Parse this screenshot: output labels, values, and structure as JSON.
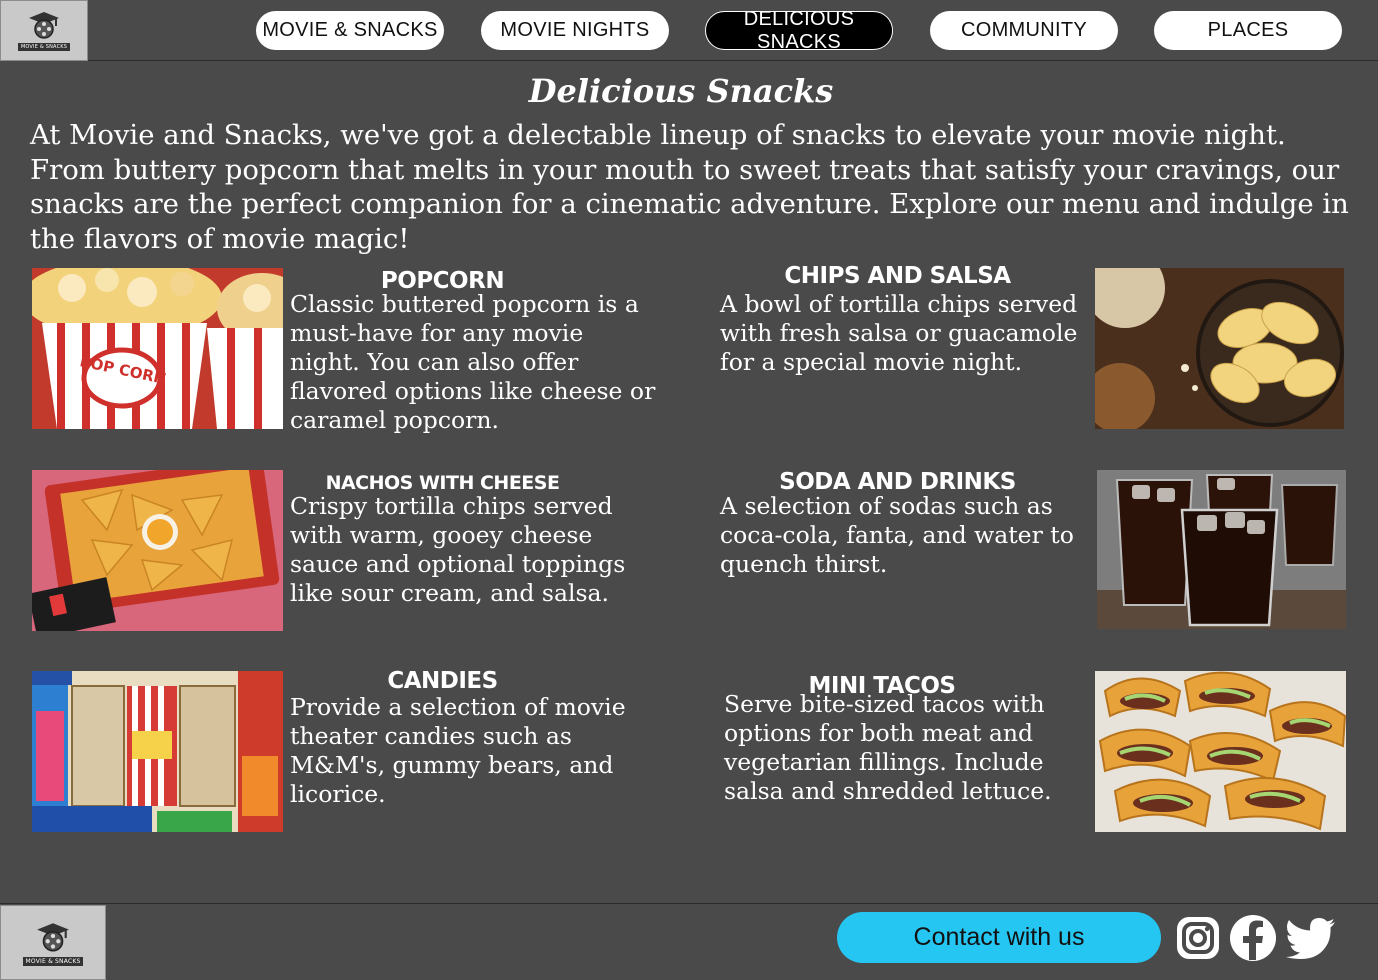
{
  "header": {
    "logo_caption": "MOVIE & SNACKS",
    "nav": [
      {
        "label": "MOVIE & SNACKS",
        "active": false
      },
      {
        "label": "MOVIE NIGHTS",
        "active": false
      },
      {
        "label": "DELICIOUS SNACKS",
        "active": true
      },
      {
        "label": "COMMUNITY",
        "active": false
      },
      {
        "label": "PLACES",
        "active": false
      }
    ]
  },
  "main": {
    "title": "Delicious Snacks",
    "intro": "At Movie and Snacks, we've got a delectable lineup of snacks to elevate your movie night. From buttery popcorn that melts in your mouth to sweet treats that satisfy your cravings, our snacks are the perfect companion for a cinematic adventure. Explore our menu and indulge in the flavors of movie magic!",
    "snacks": [
      {
        "title": "POPCORN",
        "description": "Classic buttered popcorn is a must-have for any movie night. You can also offer flavored options like cheese or caramel popcorn.",
        "image_label": "POP CORN"
      },
      {
        "title": "CHIPS AND SALSA",
        "description": "A bowl of tortilla chips served with fresh salsa or guacamole for a special movie night."
      },
      {
        "title": "NACHOS WITH CHEESE",
        "description": "Crispy tortilla chips served with warm, gooey cheese sauce and optional toppings like sour cream, and salsa."
      },
      {
        "title": "SODA AND DRINKS",
        "description": "A selection of sodas such as coca-cola, fanta, and water to quench thirst."
      },
      {
        "title": "CANDIES",
        "description": "Provide a selection of movie theater candies such as M&M's, gummy bears, and licorice."
      },
      {
        "title": "MINI TACOS",
        "description": "Serve bite-sized tacos with options for both meat and vegetarian fillings. Include salsa and shredded lettuce."
      }
    ]
  },
  "footer": {
    "logo_caption": "MOVIE & SNACKS",
    "contact_label": "Contact with us",
    "social_icons": [
      "instagram-icon",
      "facebook-icon",
      "twitter-icon"
    ]
  },
  "colors": {
    "background": "#4a4a4a",
    "nav_button": "#ffffff",
    "nav_active": "#000000",
    "contact_button": "#26c6f2"
  }
}
